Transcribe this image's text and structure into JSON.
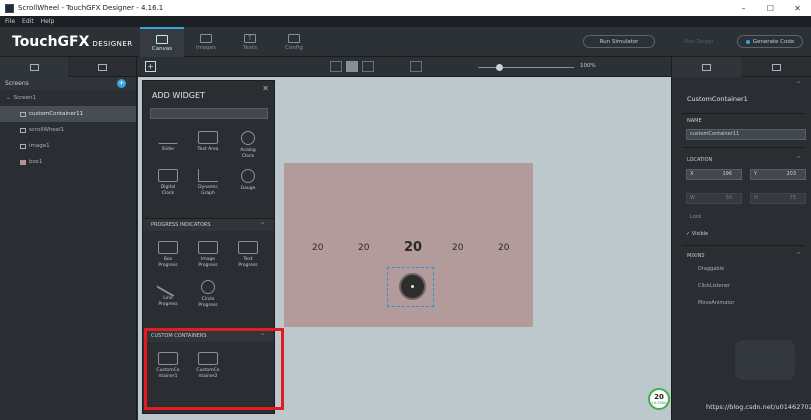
{
  "window": {
    "title": "ScrollWheel - TouchGFX Designer - 4.16.1",
    "minimize": "–",
    "maximize": "☐",
    "close": "✕"
  },
  "menu": [
    "File",
    "Edit",
    "Help"
  ],
  "header": {
    "logo": "TouchGFX",
    "logo_sub": "DESIGNER",
    "tabs": [
      {
        "label": "Canvas",
        "icon": "canvas-icon"
      },
      {
        "label": "Images",
        "icon": "images-icon"
      },
      {
        "label": "Texts",
        "icon": "texts-icon"
      },
      {
        "label": "Config",
        "icon": "config-icon"
      }
    ],
    "run_simulator": "Run Simulator",
    "run_target": "Run Target",
    "generate_code": "Generate Code"
  },
  "left_panel": {
    "screens_label": "Screens",
    "tree": [
      {
        "label": "Screen1",
        "indent": 0
      },
      {
        "label": "customContainer11",
        "indent": 1,
        "selected": true
      },
      {
        "label": "scrollWheel1",
        "indent": 1
      },
      {
        "label": "image1",
        "indent": 1
      },
      {
        "label": "box1",
        "indent": 1
      }
    ]
  },
  "canvas": {
    "zoom": "100%",
    "scroll_values": [
      "20",
      "20",
      "20",
      "20",
      "20"
    ]
  },
  "add_widget": {
    "title": "ADD WIDGET",
    "search_value": "",
    "row1": [
      {
        "label": "Slider"
      },
      {
        "label": "Text Area"
      },
      {
        "label": "Analog\nClock"
      }
    ],
    "row2": [
      {
        "label": "Digital\nClock"
      },
      {
        "label": "Dynamic\nGraph"
      },
      {
        "label": "Gauge"
      }
    ],
    "progress_header": "PROGRESS INDICATORS",
    "progress_row1": [
      {
        "label": "Box\nProgress"
      },
      {
        "label": "Image\nProgress"
      },
      {
        "label": "Text\nProgress"
      }
    ],
    "progress_row2": [
      {
        "label": "Line\nProgress"
      },
      {
        "label": "Circle\nProgress"
      }
    ],
    "custom_header": "CUSTOM CONTAINERS",
    "custom_items": [
      {
        "label": "CustomCo\nntainer1"
      },
      {
        "label": "CustomCo\nntainer2"
      }
    ]
  },
  "right_panel": {
    "title": "CustomContainer1",
    "name_label": "NAME",
    "name_value": "customContainer11",
    "location_label": "LOCATION",
    "x_label": "X",
    "x_value": "196",
    "y_label": "Y",
    "y_value": "203",
    "w_label": "W",
    "w_value": "50",
    "h_label": "H",
    "h_value": "75",
    "lock_label": "Lock",
    "visible_label": "Visible",
    "mixins_label": "MIXINS",
    "mixins": [
      "Draggable",
      "ClickListener",
      "MoveAnimator"
    ]
  },
  "status": {
    "percent": "20",
    "sub": "+0.02K/s"
  },
  "watermark": "https://blog.csdn.net/u014627029",
  "colors": {
    "accent": "#34a3e0",
    "highlight": "#e51b23",
    "canvas_bg": "#bcc8cc",
    "box": "#b29b9a"
  }
}
